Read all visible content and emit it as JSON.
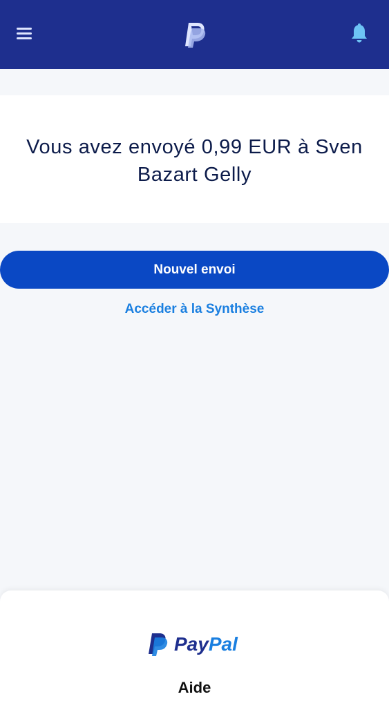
{
  "header": {
    "menu_icon": "hamburger-menu-icon",
    "logo_icon": "paypal-p-logo-icon",
    "notification_icon": "bell-icon",
    "background_color": "#1e2f8e"
  },
  "confirmation": {
    "message": "Vous avez envoyé 0,99 EUR à Sven Bazart Gelly"
  },
  "actions": {
    "new_send_label": "Nouvel envoi",
    "summary_link_label": "Accéder à la Synthèse",
    "primary_color": "#0a48c4",
    "link_color": "#1a7fe0"
  },
  "footer": {
    "logo_pay": "Pay",
    "logo_pal": "Pal",
    "help_label": "Aide"
  }
}
